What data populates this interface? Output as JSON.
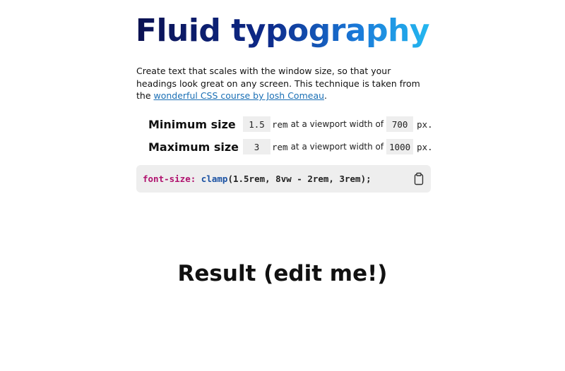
{
  "title": {
    "part1": "Fluid typo",
    "part2": "graphy"
  },
  "intro": {
    "text": "Create text that scales with the window size, so that your headings look great on any screen. This technique is taken from the ",
    "link_text": "wonderful CSS course by Josh Comeau",
    "after": "."
  },
  "minimum": {
    "label": "Minimum size",
    "rem_value": "1.5",
    "rem_unit": "rem",
    "middle_text": "at a viewport width of",
    "viewport_value": "700",
    "px_unit": "px."
  },
  "maximum": {
    "label": "Maximum size",
    "rem_value": "3",
    "rem_unit": "rem",
    "middle_text": "at a viewport width of",
    "viewport_value": "1000",
    "px_unit": "px."
  },
  "code": {
    "property": "font-size:",
    "function": "clamp",
    "args": "(1.5rem, 8vw - 2rem, 3rem);"
  },
  "result": {
    "text": "Result (edit me!)"
  },
  "colors": {
    "title_gradient_start": "#0b1151",
    "title_gradient_end": "#24b8f0",
    "link": "#1a6fb5",
    "code_property": "#b0126e",
    "code_function": "#1b52a3",
    "code_background": "#eeeeee"
  },
  "icons": {
    "copy": "clipboard-icon"
  }
}
